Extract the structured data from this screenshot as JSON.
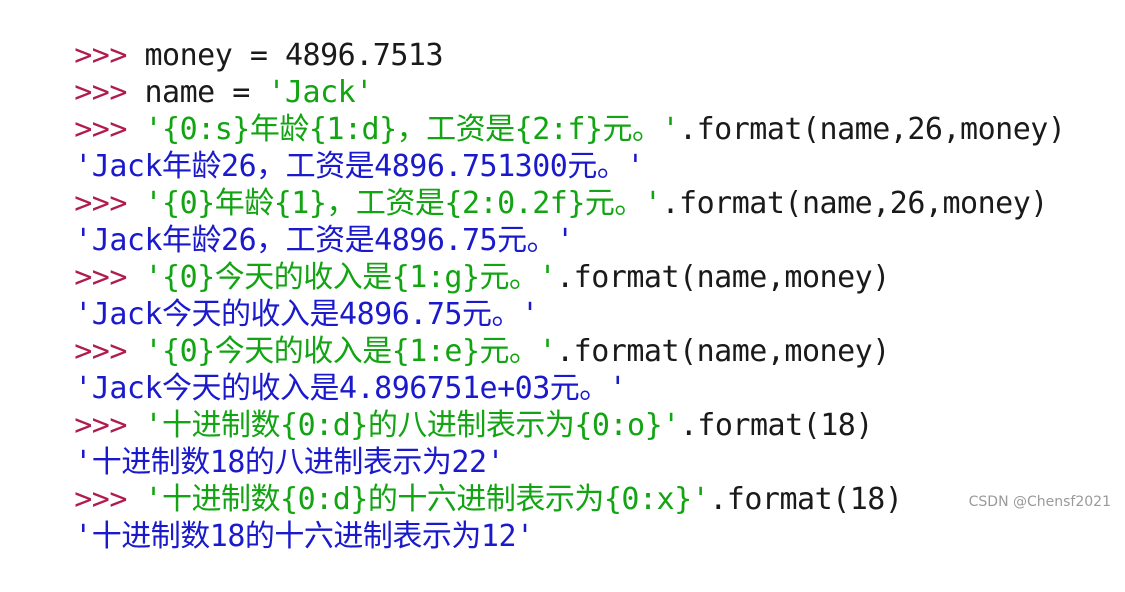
{
  "prompt": ">>> ",
  "lines": [
    {
      "kind": "input",
      "str": "",
      "code": "money = 4896.7513"
    },
    {
      "kind": "input",
      "str": "",
      "code": "name = 'Jack'"
    },
    {
      "kind": "input",
      "str": "'{0:s}年龄{1:d}，工资是{2:f}元。'",
      "code": ".format(name,26,money)"
    },
    {
      "kind": "output",
      "text": "'Jack年龄26，工资是4896.751300元。'"
    },
    {
      "kind": "input",
      "str": "'{0}年龄{1}，工资是{2:0.2f}元。'",
      "code": ".format(name,26,money)"
    },
    {
      "kind": "output",
      "text": "'Jack年龄26，工资是4896.75元。'"
    },
    {
      "kind": "input",
      "str": "'{0}今天的收入是{1:g}元。'",
      "code": ".format(name,money)"
    },
    {
      "kind": "output",
      "text": "'Jack今天的收入是4896.75元。'"
    },
    {
      "kind": "input",
      "str": "'{0}今天的收入是{1:e}元。'",
      "code": ".format(name,money)"
    },
    {
      "kind": "output",
      "text": "'Jack今天的收入是4.896751e+03元。'"
    },
    {
      "kind": "input",
      "str": "'十进制数{0:d}的八进制表示为{0:o}'",
      "code": ".format(18)"
    },
    {
      "kind": "output",
      "text": "'十进制数18的八进制表示为22'"
    },
    {
      "kind": "input",
      "str": "'十进制数{0:d}的十六进制表示为{0:x}'",
      "code": ".format(18)"
    },
    {
      "kind": "output",
      "text": "'十进制数18的十六进制表示为12'"
    }
  ],
  "watermark": "CSDN @Chensf2021",
  "colors": {
    "prompt": "#b01c4f",
    "string": "#12a412",
    "code": "#1a1a1a",
    "output": "#1a1acc"
  }
}
